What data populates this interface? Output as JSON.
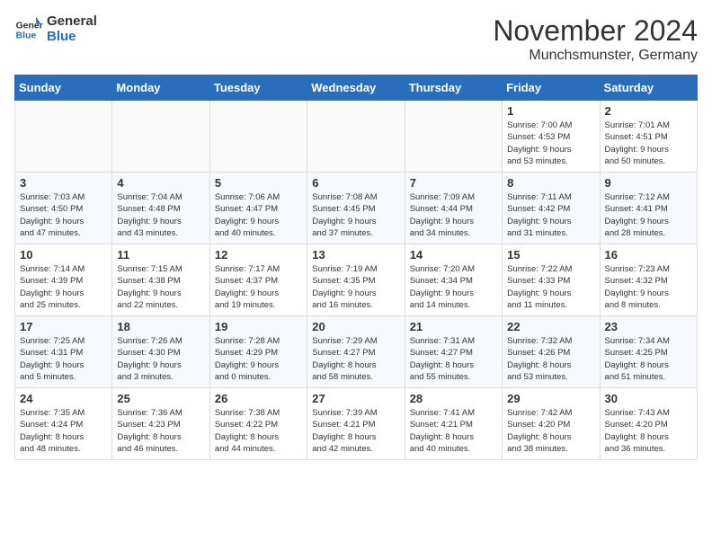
{
  "logo": {
    "general": "General",
    "blue": "Blue"
  },
  "title": "November 2024",
  "location": "Munchsmunster, Germany",
  "days_of_week": [
    "Sunday",
    "Monday",
    "Tuesday",
    "Wednesday",
    "Thursday",
    "Friday",
    "Saturday"
  ],
  "weeks": [
    [
      {
        "day": "",
        "info": ""
      },
      {
        "day": "",
        "info": ""
      },
      {
        "day": "",
        "info": ""
      },
      {
        "day": "",
        "info": ""
      },
      {
        "day": "",
        "info": ""
      },
      {
        "day": "1",
        "info": "Sunrise: 7:00 AM\nSunset: 4:53 PM\nDaylight: 9 hours\nand 53 minutes."
      },
      {
        "day": "2",
        "info": "Sunrise: 7:01 AM\nSunset: 4:51 PM\nDaylight: 9 hours\nand 50 minutes."
      }
    ],
    [
      {
        "day": "3",
        "info": "Sunrise: 7:03 AM\nSunset: 4:50 PM\nDaylight: 9 hours\nand 47 minutes."
      },
      {
        "day": "4",
        "info": "Sunrise: 7:04 AM\nSunset: 4:48 PM\nDaylight: 9 hours\nand 43 minutes."
      },
      {
        "day": "5",
        "info": "Sunrise: 7:06 AM\nSunset: 4:47 PM\nDaylight: 9 hours\nand 40 minutes."
      },
      {
        "day": "6",
        "info": "Sunrise: 7:08 AM\nSunset: 4:45 PM\nDaylight: 9 hours\nand 37 minutes."
      },
      {
        "day": "7",
        "info": "Sunrise: 7:09 AM\nSunset: 4:44 PM\nDaylight: 9 hours\nand 34 minutes."
      },
      {
        "day": "8",
        "info": "Sunrise: 7:11 AM\nSunset: 4:42 PM\nDaylight: 9 hours\nand 31 minutes."
      },
      {
        "day": "9",
        "info": "Sunrise: 7:12 AM\nSunset: 4:41 PM\nDaylight: 9 hours\nand 28 minutes."
      }
    ],
    [
      {
        "day": "10",
        "info": "Sunrise: 7:14 AM\nSunset: 4:39 PM\nDaylight: 9 hours\nand 25 minutes."
      },
      {
        "day": "11",
        "info": "Sunrise: 7:15 AM\nSunset: 4:38 PM\nDaylight: 9 hours\nand 22 minutes."
      },
      {
        "day": "12",
        "info": "Sunrise: 7:17 AM\nSunset: 4:37 PM\nDaylight: 9 hours\nand 19 minutes."
      },
      {
        "day": "13",
        "info": "Sunrise: 7:19 AM\nSunset: 4:35 PM\nDaylight: 9 hours\nand 16 minutes."
      },
      {
        "day": "14",
        "info": "Sunrise: 7:20 AM\nSunset: 4:34 PM\nDaylight: 9 hours\nand 14 minutes."
      },
      {
        "day": "15",
        "info": "Sunrise: 7:22 AM\nSunset: 4:33 PM\nDaylight: 9 hours\nand 11 minutes."
      },
      {
        "day": "16",
        "info": "Sunrise: 7:23 AM\nSunset: 4:32 PM\nDaylight: 9 hours\nand 8 minutes."
      }
    ],
    [
      {
        "day": "17",
        "info": "Sunrise: 7:25 AM\nSunset: 4:31 PM\nDaylight: 9 hours\nand 5 minutes."
      },
      {
        "day": "18",
        "info": "Sunrise: 7:26 AM\nSunset: 4:30 PM\nDaylight: 9 hours\nand 3 minutes."
      },
      {
        "day": "19",
        "info": "Sunrise: 7:28 AM\nSunset: 4:29 PM\nDaylight: 9 hours\nand 0 minutes."
      },
      {
        "day": "20",
        "info": "Sunrise: 7:29 AM\nSunset: 4:27 PM\nDaylight: 8 hours\nand 58 minutes."
      },
      {
        "day": "21",
        "info": "Sunrise: 7:31 AM\nSunset: 4:27 PM\nDaylight: 8 hours\nand 55 minutes."
      },
      {
        "day": "22",
        "info": "Sunrise: 7:32 AM\nSunset: 4:26 PM\nDaylight: 8 hours\nand 53 minutes."
      },
      {
        "day": "23",
        "info": "Sunrise: 7:34 AM\nSunset: 4:25 PM\nDaylight: 8 hours\nand 51 minutes."
      }
    ],
    [
      {
        "day": "24",
        "info": "Sunrise: 7:35 AM\nSunset: 4:24 PM\nDaylight: 8 hours\nand 48 minutes."
      },
      {
        "day": "25",
        "info": "Sunrise: 7:36 AM\nSunset: 4:23 PM\nDaylight: 8 hours\nand 46 minutes."
      },
      {
        "day": "26",
        "info": "Sunrise: 7:38 AM\nSunset: 4:22 PM\nDaylight: 8 hours\nand 44 minutes."
      },
      {
        "day": "27",
        "info": "Sunrise: 7:39 AM\nSunset: 4:21 PM\nDaylight: 8 hours\nand 42 minutes."
      },
      {
        "day": "28",
        "info": "Sunrise: 7:41 AM\nSunset: 4:21 PM\nDaylight: 8 hours\nand 40 minutes."
      },
      {
        "day": "29",
        "info": "Sunrise: 7:42 AM\nSunset: 4:20 PM\nDaylight: 8 hours\nand 38 minutes."
      },
      {
        "day": "30",
        "info": "Sunrise: 7:43 AM\nSunset: 4:20 PM\nDaylight: 8 hours\nand 36 minutes."
      }
    ]
  ]
}
